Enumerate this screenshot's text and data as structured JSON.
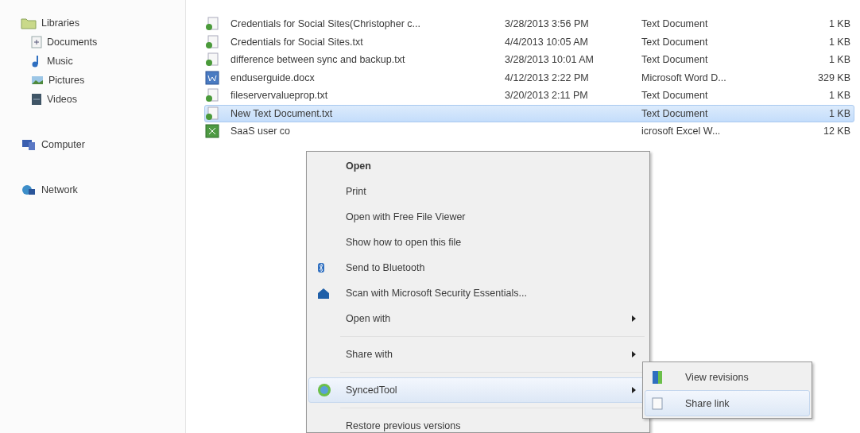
{
  "sidebar": {
    "items": [
      {
        "label": "Libraries",
        "children": [
          {
            "label": "Documents"
          },
          {
            "label": "Music"
          },
          {
            "label": "Pictures"
          },
          {
            "label": "Videos"
          }
        ]
      },
      {
        "label": "Computer"
      },
      {
        "label": "Network"
      }
    ]
  },
  "file_list": {
    "rows": [
      {
        "kind": "text",
        "name": "Credentials for Social Sites(Christopher c...",
        "date": "3/28/2013 3:56 PM",
        "type": "Text Document",
        "size": "1 KB",
        "selected": false
      },
      {
        "kind": "text",
        "name": "Credentials for Social Sites.txt",
        "date": "4/4/2013 10:05 AM",
        "type": "Text Document",
        "size": "1 KB",
        "selected": false
      },
      {
        "kind": "text",
        "name": "difference between sync and backup.txt",
        "date": "3/28/2013 10:01 AM",
        "type": "Text Document",
        "size": "1 KB",
        "selected": false
      },
      {
        "kind": "word",
        "name": "enduserguide.docx",
        "date": "4/12/2013 2:22 PM",
        "type": "Microsoft Word D...",
        "size": "329 KB",
        "selected": false
      },
      {
        "kind": "text",
        "name": "fileservervalueprop.txt",
        "date": "3/20/2013 2:11 PM",
        "type": "Text Document",
        "size": "1 KB",
        "selected": false
      },
      {
        "kind": "text",
        "name": "New Text Document.txt",
        "type": "Text Document",
        "size": "1 KB",
        "selected": true
      },
      {
        "kind": "excel",
        "name": "SaaS user co",
        "type": "icrosoft Excel W...",
        "size": "12 KB",
        "selected": false
      }
    ]
  },
  "context_menu": {
    "items": [
      {
        "kind": "item",
        "label": "Open",
        "bold": true,
        "submenu": false,
        "selected": false
      },
      {
        "kind": "item",
        "label": "Print",
        "bold": false,
        "submenu": false,
        "selected": false
      },
      {
        "kind": "item",
        "label": "Open with Free File Viewer",
        "bold": false,
        "submenu": false,
        "selected": false
      },
      {
        "kind": "item",
        "label": "Show how to open this file",
        "bold": false,
        "submenu": false,
        "selected": false
      },
      {
        "kind": "item",
        "label": "Send to Bluetooth",
        "bold": false,
        "submenu": false,
        "selected": false
      },
      {
        "kind": "item",
        "label": "Scan with Microsoft Security Essentials...",
        "bold": false,
        "submenu": false,
        "selected": false
      },
      {
        "kind": "item",
        "label": "Open with",
        "bold": false,
        "submenu": true,
        "selected": false
      },
      {
        "kind": "separator"
      },
      {
        "kind": "item",
        "label": "Share with",
        "bold": false,
        "submenu": true,
        "selected": false
      },
      {
        "kind": "separator"
      },
      {
        "kind": "item",
        "label": "SyncedTool",
        "bold": false,
        "submenu": true,
        "selected": true
      },
      {
        "kind": "separator"
      },
      {
        "kind": "item",
        "label": "Restore previous versions",
        "bold": false,
        "submenu": false,
        "selected": false
      }
    ]
  },
  "submenu": {
    "items": [
      {
        "label": "View revisions",
        "selected": false
      },
      {
        "label": "Share link",
        "selected": true
      }
    ]
  }
}
